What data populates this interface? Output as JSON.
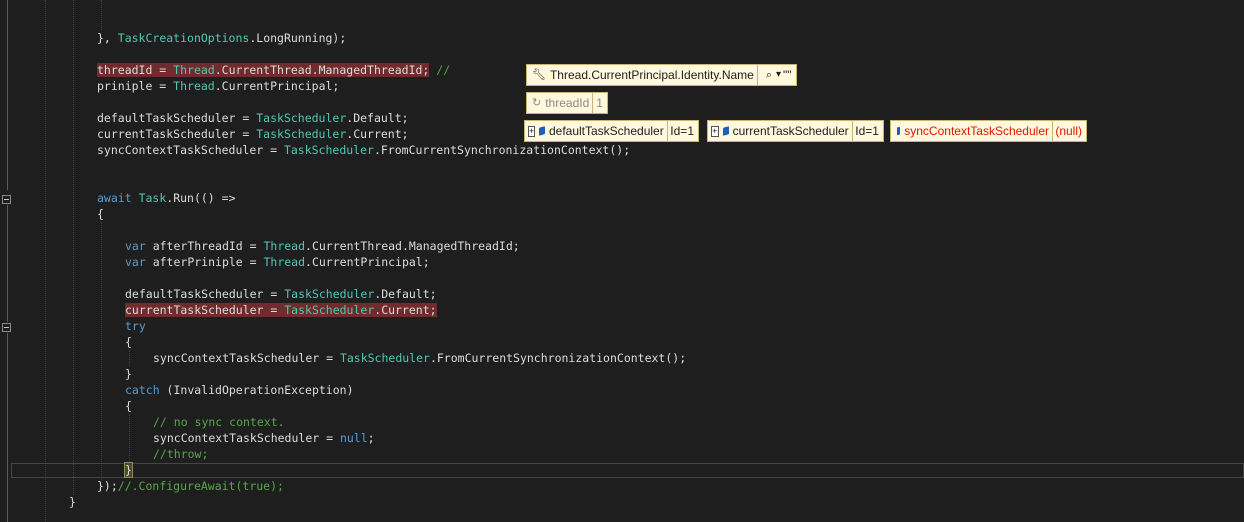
{
  "editor": {
    "lines": [
      {
        "id": "l1",
        "parts": [
          {
            "t": "}, "
          },
          {
            "t": "TaskCreationOptions",
            "c": "ty"
          },
          {
            "t": ".LongRunning);"
          }
        ]
      },
      {
        "id": "l2",
        "parts": [
          {
            "t": "threadId = ",
            "c": "hl"
          },
          {
            "t": "Thread",
            "c": "ty hl"
          },
          {
            "t": ".CurrentThread.ManagedThreadId;",
            "c": "hl"
          },
          {
            "t": " //",
            "c": "cm"
          }
        ]
      },
      {
        "id": "l3",
        "parts": [
          {
            "t": "priniple = "
          },
          {
            "t": "Thread",
            "c": "ty"
          },
          {
            "t": ".CurrentPrincipal;"
          }
        ]
      },
      {
        "id": "l4",
        "parts": [
          {
            "t": "defaultTaskScheduler = "
          },
          {
            "t": "TaskScheduler",
            "c": "ty"
          },
          {
            "t": ".Default;"
          }
        ]
      },
      {
        "id": "l5",
        "parts": [
          {
            "t": "currentTaskScheduler = "
          },
          {
            "t": "TaskScheduler",
            "c": "ty"
          },
          {
            "t": ".Current;"
          }
        ]
      },
      {
        "id": "l6",
        "parts": [
          {
            "t": "syncContextTaskScheduler = "
          },
          {
            "t": "TaskScheduler",
            "c": "ty"
          },
          {
            "t": ".FromCurrentSynchronizationContext();"
          }
        ]
      },
      {
        "id": "l7",
        "parts": [
          {
            "t": "await",
            "c": "kw"
          },
          {
            "t": " "
          },
          {
            "t": "Task",
            "c": "ty"
          },
          {
            "t": ".Run(() =>"
          }
        ]
      },
      {
        "id": "l8",
        "parts": [
          {
            "t": "{"
          }
        ]
      },
      {
        "id": "l9",
        "parts": [
          {
            "t": "var",
            "c": "kw"
          },
          {
            "t": " afterThreadId = "
          },
          {
            "t": "Thread",
            "c": "ty"
          },
          {
            "t": ".CurrentThread.ManagedThreadId;"
          }
        ]
      },
      {
        "id": "l10",
        "parts": [
          {
            "t": "var",
            "c": "kw"
          },
          {
            "t": " afterPriniple = "
          },
          {
            "t": "Thread",
            "c": "ty"
          },
          {
            "t": ".CurrentPrincipal;"
          }
        ]
      },
      {
        "id": "l11",
        "parts": [
          {
            "t": "defaultTaskScheduler = "
          },
          {
            "t": "TaskScheduler",
            "c": "ty"
          },
          {
            "t": ".Default;"
          }
        ]
      },
      {
        "id": "l12",
        "parts": [
          {
            "t": "currentTaskScheduler = ",
            "c": "hl"
          },
          {
            "t": "TaskScheduler",
            "c": "ty hl"
          },
          {
            "t": ".Current;",
            "c": "hl"
          }
        ]
      },
      {
        "id": "l13",
        "parts": [
          {
            "t": "try",
            "c": "kw"
          }
        ]
      },
      {
        "id": "l14",
        "parts": [
          {
            "t": "{"
          }
        ]
      },
      {
        "id": "l15",
        "parts": [
          {
            "t": "syncContextTaskScheduler = "
          },
          {
            "t": "TaskScheduler",
            "c": "ty"
          },
          {
            "t": ".FromCurrentSynchronizationContext();"
          }
        ]
      },
      {
        "id": "l16",
        "parts": [
          {
            "t": "}"
          }
        ]
      },
      {
        "id": "l17",
        "parts": [
          {
            "t": "catch",
            "c": "kw"
          },
          {
            "t": " ("
          },
          {
            "t": "InvalidOperationException",
            "c": ""
          },
          {
            "t": ")"
          }
        ]
      },
      {
        "id": "l18",
        "parts": [
          {
            "t": "{"
          }
        ]
      },
      {
        "id": "l19",
        "parts": [
          {
            "t": "// no sync context.",
            "c": "cm"
          }
        ]
      },
      {
        "id": "l20",
        "parts": [
          {
            "t": "syncContextTaskScheduler = "
          },
          {
            "t": "null",
            "c": "kw"
          },
          {
            "t": ";"
          }
        ]
      },
      {
        "id": "l21",
        "parts": [
          {
            "t": "//throw;",
            "c": "cm"
          }
        ]
      },
      {
        "id": "l22",
        "parts": [
          {
            "t": "}",
            "c": "bm"
          }
        ]
      },
      {
        "id": "l23",
        "parts": [
          {
            "t": "});"
          },
          {
            "t": "//.ConfigureAwait(true);",
            "c": "cm"
          }
        ]
      },
      {
        "id": "l24",
        "parts": [
          {
            "t": "}"
          }
        ]
      }
    ]
  },
  "datatips": {
    "principal": {
      "expr": "Thread.CurrentPrincipal.Identity.Name",
      "value": "\"\"",
      "icon": "wrench-icon",
      "search_icon": "search-icon"
    },
    "threadId": {
      "name": "threadId",
      "value": "1",
      "icon": "refresh-icon"
    },
    "defaultTS": {
      "name": "defaultTaskScheduler",
      "value": "Id=1"
    },
    "currentTS": {
      "name": "currentTaskScheduler",
      "value": "Id=1"
    },
    "syncTS": {
      "name": "syncContextTaskScheduler",
      "value": "(null)"
    }
  },
  "colors": {
    "background": "#1e1e1e",
    "keyword": "#569cd6",
    "type": "#4ec9b0",
    "comment": "#57a64a",
    "breakpoint_highlight": "#6e2c2c",
    "datatip_bg": "#fff8dc",
    "error_text": "#e51400"
  }
}
